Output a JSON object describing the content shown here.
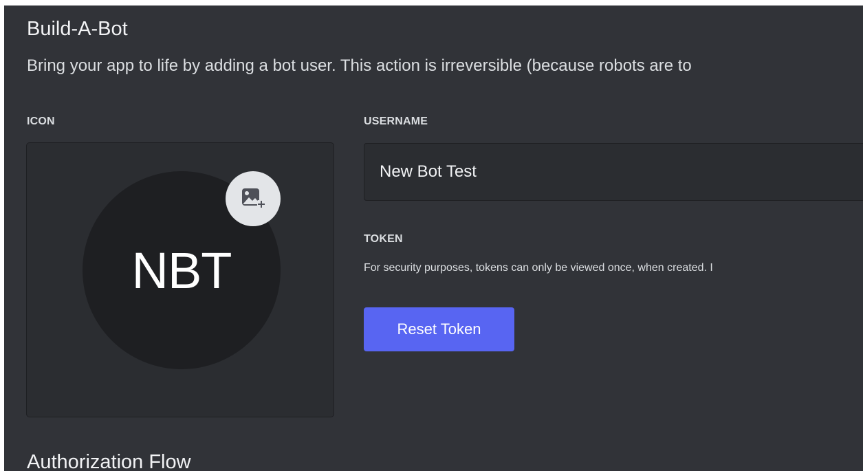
{
  "build_a_bot": {
    "title": "Build-A-Bot",
    "description": "Bring your app to life by adding a bot user. This action is irreversible (because robots are to",
    "icon_label": "ICON",
    "avatar_initials": "NBT",
    "upload_icon": "image-plus-icon",
    "username_label": "USERNAME",
    "username_value": "New Bot Test",
    "token_label": "TOKEN",
    "token_description": "For security purposes, tokens can only be viewed once, when created. I",
    "reset_token_label": "Reset Token"
  },
  "next_section": {
    "title": "Authorization Flow"
  },
  "colors": {
    "panel_bg": "#313338",
    "input_bg": "#2b2d31",
    "avatar_bg": "#1e1f22",
    "blurple": "#5865f2",
    "badge_bg": "#e3e5e8"
  }
}
